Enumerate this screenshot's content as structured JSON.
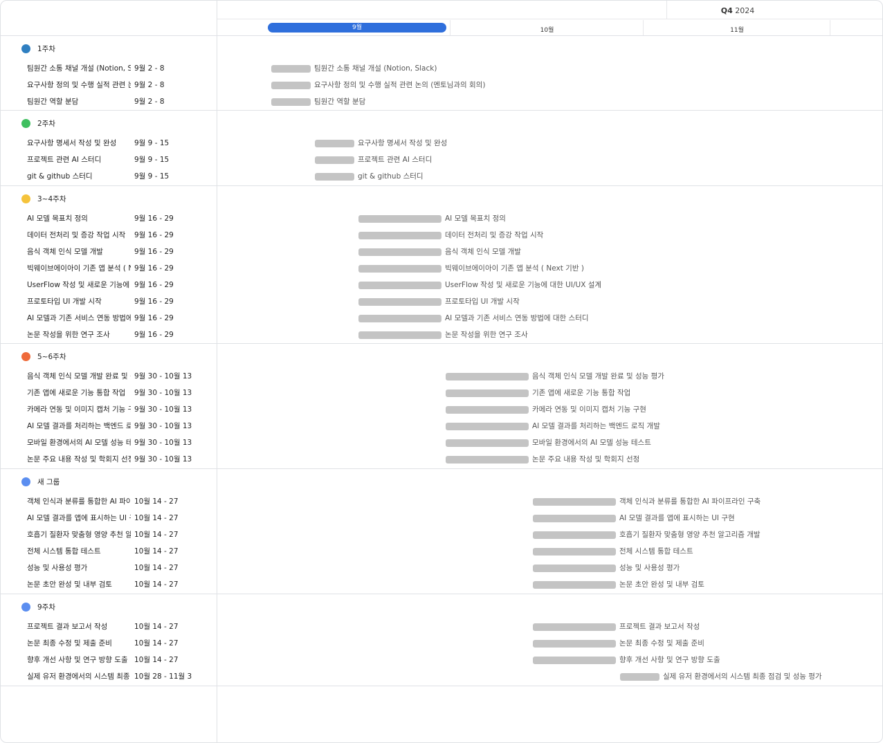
{
  "header": {
    "quarter_bold": "Q4",
    "quarter_year": "2024",
    "months": [
      "9월",
      "10월",
      "11월"
    ]
  },
  "groups": [
    {
      "title": "1주차",
      "color": "#2f7fc1",
      "tasks": [
        {
          "name": "팀원간 소통 채널 개설 (Notion, Slack)",
          "date": "9월 2 - 8",
          "label": "팀원간 소통 채널 개설 (Notion, Slack)"
        },
        {
          "name": "요구사항 정의 및 수행 실적 관련 논의 (멘토님과의 회의)",
          "date": "9월 2 - 8",
          "label": "요구사항 정의 및 수행 실적 관련 논의 (멘토님과의 회의)"
        },
        {
          "name": "팀원간 역할 분담",
          "date": "9월 2 - 8",
          "label": "팀원간 역할 분담"
        }
      ]
    },
    {
      "title": "2주차",
      "color": "#3fbf5f",
      "tasks": [
        {
          "name": "요구사항 명세서 작성 및 완성",
          "date": "9월 9 - 15",
          "label": "요구사항 명세서 작성 및 완성"
        },
        {
          "name": "프로젝트 관련 AI 스터디",
          "date": "9월 9 - 15",
          "label": "프로젝트 관련 AI 스터디"
        },
        {
          "name": "git & github 스터디",
          "date": "9월 9 - 15",
          "label": "git & github 스터디"
        }
      ]
    },
    {
      "title": "3~4주차",
      "color": "#f5c33b",
      "tasks": [
        {
          "name": "AI 모델 목표치 정의",
          "date": "9월 16 - 29",
          "label": "AI 모델 목표치 정의"
        },
        {
          "name": "데이터 전처리 및 증강 작업 시작",
          "date": "9월 16 - 29",
          "label": "데이터 전처리 및 증강 작업 시작"
        },
        {
          "name": "음식 객체 인식 모델 개발",
          "date": "9월 16 - 29",
          "label": "음식 객체 인식 모델 개발"
        },
        {
          "name": "빅웨이브에이아이 기존 앱 분석 ( Next 기반 )",
          "date": "9월 16 - 29",
          "label": "빅웨이브에이아이 기존 앱 분석 ( Next 기반 )"
        },
        {
          "name": "UserFlow 작성 및 새로운 기능에 대한 UI/UX 설계",
          "date": "9월 16 - 29",
          "label": "UserFlow 작성 및 새로운 기능에 대한 UI/UX 설계"
        },
        {
          "name": "프로토타입 UI 개발 시작",
          "date": "9월 16 - 29",
          "label": "프로토타입 UI 개발 시작"
        },
        {
          "name": "AI 모델과 기존 서비스 연동 방법에 대한 스터디",
          "date": "9월 16 - 29",
          "label": "AI 모델과 기존 서비스 연동 방법에 대한 스터디"
        },
        {
          "name": "논문 작성을 위한 연구 조사",
          "date": "9월 16 - 29",
          "label": "논문 작성을 위한 연구 조사"
        }
      ]
    },
    {
      "title": "5~6주차",
      "color": "#ef6a3a",
      "tasks": [
        {
          "name": "음식 객체 인식 모델 개발 완료 및 성능 평가",
          "date": "9월 30 - 10월 13",
          "label": "음식 객체 인식 모델 개발 완료 및 성능 평가"
        },
        {
          "name": "기존 앱에 새로운 기능 통합 작업",
          "date": "9월 30 - 10월 13",
          "label": "기존 앱에 새로운 기능 통합 작업"
        },
        {
          "name": "카메라 연동 및 이미지 캡처 기능 구현",
          "date": "9월 30 - 10월 13",
          "label": "카메라 연동 및 이미지 캡처 기능 구현"
        },
        {
          "name": "AI 모델 결과를 처리하는 백엔드 로직 개발",
          "date": "9월 30 - 10월 13",
          "label": "AI 모델 결과를 처리하는 백엔드 로직 개발"
        },
        {
          "name": "모바일 환경에서의 AI 모델 성능 테스트",
          "date": "9월 30 - 10월 13",
          "label": "모바일 환경에서의 AI 모델 성능 테스트"
        },
        {
          "name": "논문 주요 내용 작성 및 학회지 선정",
          "date": "9월 30 - 10월 13",
          "label": "논문 주요 내용 작성 및 학회지 선정"
        }
      ]
    },
    {
      "title": "새 그룹",
      "color": "#5b8ef0",
      "tasks": [
        {
          "name": "객체 인식과 분류를 통합한 AI 파이프라인 구축",
          "date": "10월 14 - 27",
          "label": "객체 인식과 분류를 통합한 AI 파이프라인 구축"
        },
        {
          "name": "AI 모델 결과를 앱에 표시하는 UI 구현",
          "date": "10월 14 - 27",
          "label": "AI 모델 결과를 앱에 표시하는 UI 구현"
        },
        {
          "name": "호흡기 질환자 맞춤형 영양 추천 알고리즘 개발",
          "date": "10월 14 - 27",
          "label": "호흡기 질환자 맞춤형 영양 추천 알고리즘 개발"
        },
        {
          "name": "전체 시스템 통합 테스트",
          "date": "10월 14 - 27",
          "label": "전체 시스템 통합 테스트"
        },
        {
          "name": "성능 및 사용성 평가",
          "date": "10월 14 - 27",
          "label": "성능 및 사용성 평가"
        },
        {
          "name": "논문 초안 완성 및 내부 검토",
          "date": "10월 14 - 27",
          "label": "논문 초안 완성 및 내부 검토"
        }
      ]
    },
    {
      "title": "9주차",
      "color": "#5b8ef0",
      "tasks": [
        {
          "name": "프로젝트 결과 보고서 작성",
          "date": "10월 14 - 27",
          "label": "프로젝트 결과 보고서 작성"
        },
        {
          "name": "논문 최종 수정 및 제출 준비",
          "date": "10월 14 - 27",
          "label": "논문 최종 수정 및 제출 준비"
        },
        {
          "name": "향후 개선 사항 및 연구 방향 도출",
          "date": "10월 14 - 27",
          "label": "향후 개선 사항 및 연구 방향 도출"
        },
        {
          "name": "실제 유저 환경에서의 시스템 최종 점검 및 성능 평가",
          "date": "10월 28 - 11월 3",
          "label": "실제 유저 환경에서의 시스템 최종 점검 및 성능 평가"
        }
      ]
    }
  ]
}
